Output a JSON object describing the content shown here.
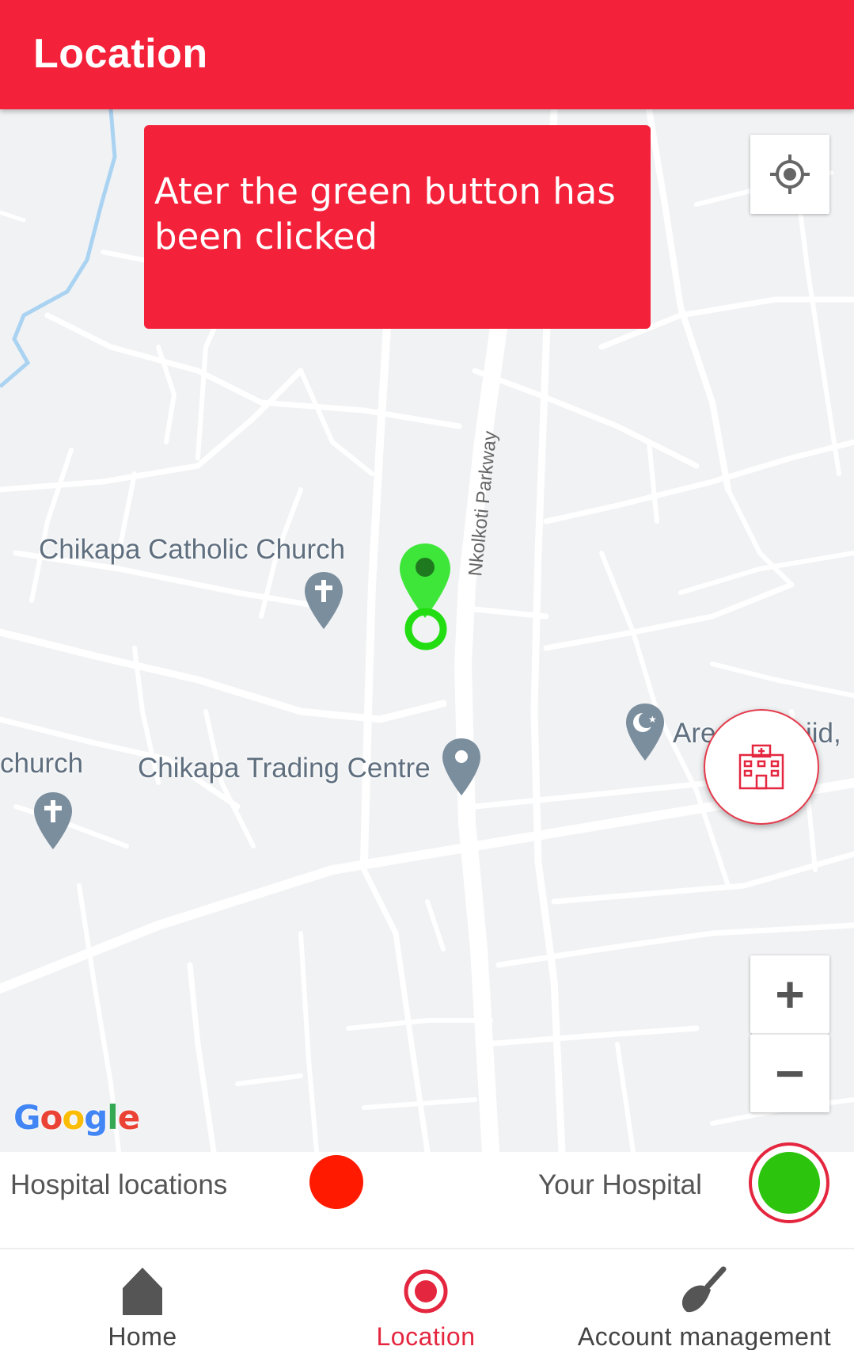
{
  "appbar": {
    "title": "Location"
  },
  "banner": {
    "text": "Ater the green button has been clicked"
  },
  "map": {
    "pois": {
      "catholic_church": "Chikapa Catholic Church",
      "trading_centre": "Chikapa Trading Centre",
      "church_partial": "church",
      "masjid_left": "Are",
      "masjid_right": "jid,"
    },
    "road_label": "Nkolkoti Parkway",
    "logo": "Google",
    "zoom_in": "+",
    "zoom_out": "−",
    "icons": [
      "my-location-icon",
      "hospital-icon",
      "church-pin-icon",
      "mosque-pin-icon",
      "place-pin-icon",
      "selected-location-marker-icon"
    ]
  },
  "legend": {
    "hospital_locations": "Hospital locations",
    "your_hospital": "Your Hospital",
    "colors": {
      "hospital_locations": "#ff1a00",
      "your_hospital": "#2dc40e"
    }
  },
  "bottom_nav": {
    "items": [
      {
        "label": "Home",
        "icon": "home-icon"
      },
      {
        "label": "Location",
        "icon": "radio-target-icon"
      },
      {
        "label": "Account management",
        "icon": "broom-icon"
      }
    ],
    "active": "Location",
    "accent": "#e4263f"
  }
}
